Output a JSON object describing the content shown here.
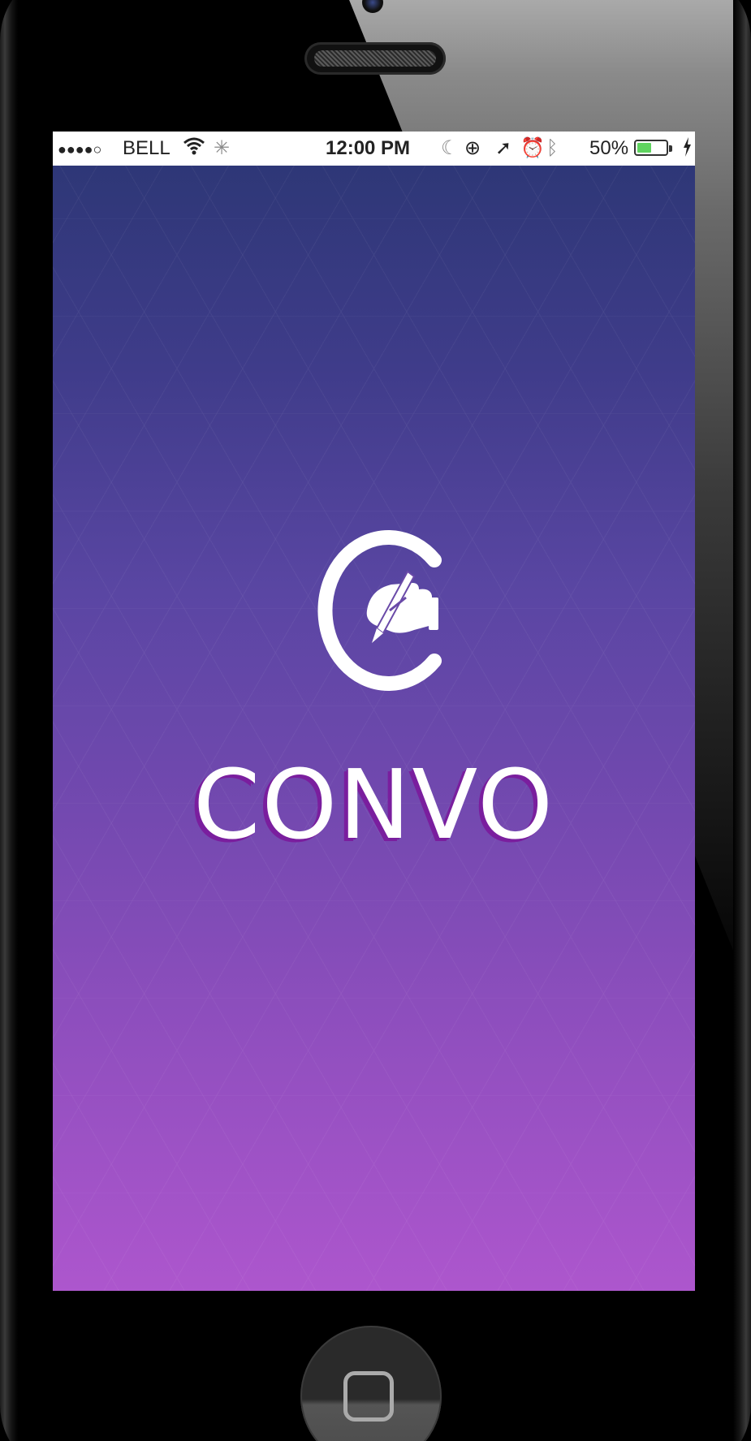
{
  "status_bar": {
    "signal": "●●●●○",
    "carrier": "BELL",
    "time": "12:00 PM",
    "battery_percent": "50%",
    "battery_level": 0.5,
    "icons": [
      "wifi-icon",
      "activity-icon",
      "moon-icon",
      "rotation-lock-icon",
      "location-icon",
      "alarm-icon",
      "bluetooth-icon",
      "battery-icon",
      "charging-bolt-icon"
    ]
  },
  "splash": {
    "brand_name": "CONVO",
    "logo_icon": "c-hand-writing-icon",
    "gradient_top": "#2e3777",
    "gradient_bottom": "#ad56cd"
  }
}
